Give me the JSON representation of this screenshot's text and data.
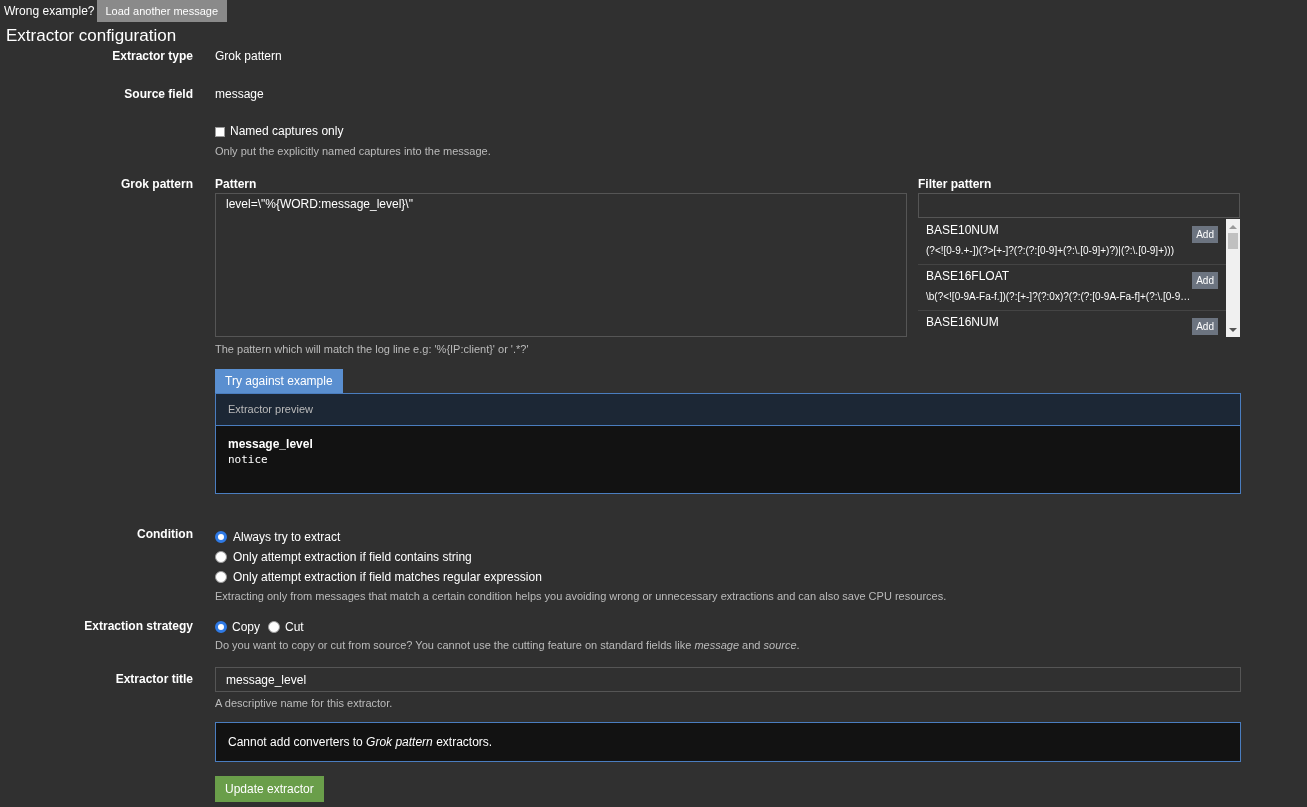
{
  "top_bar": {
    "question": "Wrong example?",
    "button": "Load another message"
  },
  "heading": "Extractor configuration",
  "extractor_type": {
    "label": "Extractor type",
    "value": "Grok pattern"
  },
  "source_field": {
    "label": "Source field",
    "value": "message"
  },
  "named_captures": {
    "label": "Named captures only",
    "checked": false,
    "help": "Only put the explicitly named captures into the message."
  },
  "grok_pattern": {
    "label": "Grok pattern",
    "pattern_label": "Pattern",
    "pattern": "level=\\\"%{WORD:message_level}\\\"",
    "pattern_help": "The pattern which will match the log line e.g: '%{IP:client}' or '.*?'",
    "filter_label": "Filter pattern",
    "patterns": [
      {
        "name": "BASE10NUM",
        "regex": "(?<![0-9.+-])(?>[+-]?(?:(?:[0-9]+(?:\\.[0-9]+)?)|(?:\\.[0-9]+)))",
        "button": "Add"
      },
      {
        "name": "BASE16FLOAT",
        "regex": "\\b(?<![0-9A-Fa-f.])(?:[+-]?(?:0x)?(?:(?:[0-9A-Fa-f]+(?:\\.[0-9…",
        "button": "Add"
      },
      {
        "name": "BASE16NUM",
        "button": "Add"
      }
    ]
  },
  "preview": {
    "tab": "Try against example",
    "header": "Extractor preview",
    "field": "message_level",
    "value": "notice"
  },
  "condition": {
    "label": "Condition",
    "options": [
      {
        "label": "Always try to extract",
        "selected": true
      },
      {
        "label": "Only attempt extraction if field contains string",
        "selected": false
      },
      {
        "label": "Only attempt extraction if field matches regular expression",
        "selected": false
      }
    ],
    "help": "Extracting only from messages that match a certain condition helps you avoiding wrong or unnecessary extractions and can also save CPU resources."
  },
  "strategy": {
    "label": "Extraction strategy",
    "options": [
      {
        "label": "Copy",
        "selected": true
      },
      {
        "label": "Cut",
        "selected": false
      }
    ],
    "help": "Do you want to copy or cut from source? You cannot use the cutting feature on standard fields like *message* and *source*."
  },
  "title": {
    "label": "Extractor title",
    "value": "message_level",
    "help": "A descriptive name for this extractor."
  },
  "converters_note": "Cannot add converters to *Grok pattern* extractors.",
  "submit": "Update extractor"
}
